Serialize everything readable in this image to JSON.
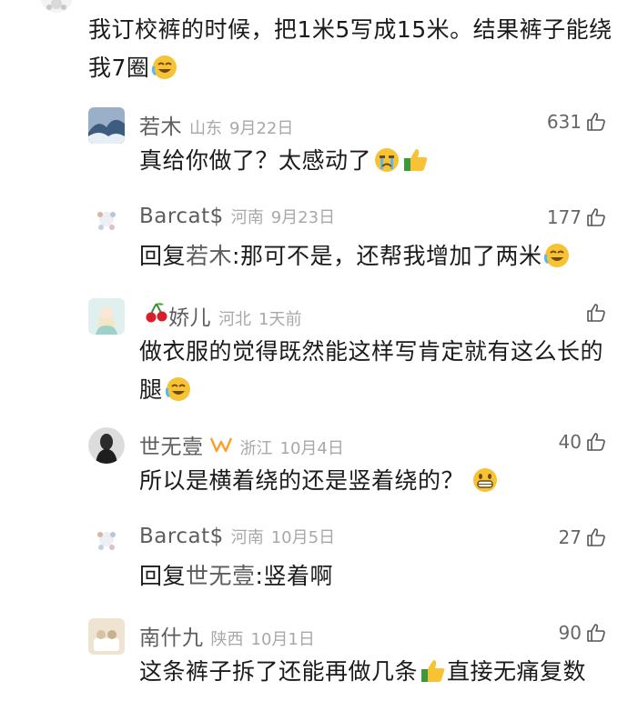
{
  "top_comment": {
    "text": "我订校裤的时候，把1米5写成15米。结果裤子能绕我7圈"
  },
  "replies": [
    {
      "name": "若木",
      "region": "山东",
      "date": "9月22日",
      "likes": "631",
      "body": "真给你做了？太感动了"
    },
    {
      "name": "Barcat$",
      "region": "河南",
      "date": "9月23日",
      "likes": "177",
      "reply_prefix": "回复",
      "mention": "若木",
      "body": ":那可不是，还帮我增加了两米"
    },
    {
      "name": "娇儿",
      "region": "河北",
      "date": "1天前",
      "likes": "",
      "body": "做衣服的觉得既然能这样写肯定就有这么长的腿"
    },
    {
      "name": "世无壹",
      "region": "浙江",
      "date": "10月4日",
      "likes": "40",
      "body": "所以是横着绕的还是竖着绕的？"
    },
    {
      "name": "Barcat$",
      "region": "河南",
      "date": "10月5日",
      "likes": "27",
      "reply_prefix": "回复",
      "mention": "世无壹",
      "body": ":竖着啊"
    },
    {
      "name": "南什九",
      "region": "陕西",
      "date": "10月1日",
      "likes": "90",
      "body": "这条裤子拆了还能再做几条",
      "body_after": "直接无痛复数"
    }
  ],
  "icons": {
    "like": "thumbs-up-outline-icon",
    "emoji_laugh_cry": "laughing-crying-emoji",
    "emoji_crying": "crying-emoji",
    "emoji_thumbs": "thumbs-up-emoji",
    "emoji_grin": "grinning-emoji",
    "cherry": "cherry-emoji",
    "badge": "vip-badge-icon"
  },
  "colors": {
    "text": "#1b1b1b",
    "name": "#5d5d5d",
    "meta": "#a8a8a8",
    "emoji_yellow": "#f7c233"
  }
}
